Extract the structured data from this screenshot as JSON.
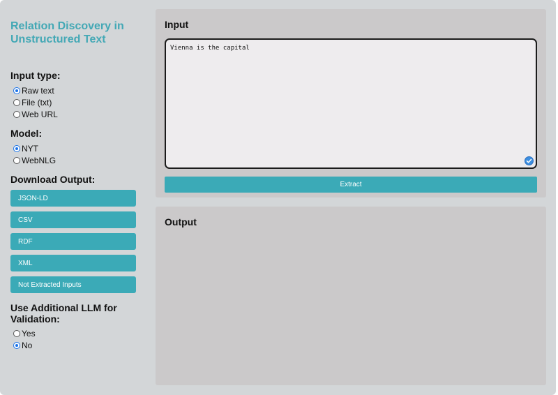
{
  "sidebar": {
    "title_line1": "Relation Discovery in",
    "title_line2": "Unstructured Text",
    "input_type": {
      "label": "Input type:",
      "options": [
        "Raw text",
        "File (txt)",
        "Web URL"
      ],
      "selected": "Raw text"
    },
    "model": {
      "label": "Model:",
      "options": [
        "NYT",
        "WebNLG"
      ],
      "selected": "NYT"
    },
    "download": {
      "label": "Download Output:",
      "buttons": [
        "JSON-LD",
        "CSV",
        "RDF",
        "XML",
        "Not Extracted Inputs"
      ]
    },
    "validation": {
      "label_line1": "Use Additional LLM for",
      "label_line2": "Validation:",
      "options": [
        "Yes",
        "No"
      ],
      "selected": "No"
    }
  },
  "input_panel": {
    "title": "Input",
    "text_value": "Vienna is the capital",
    "extract_label": "Extract"
  },
  "output_panel": {
    "title": "Output"
  },
  "colors": {
    "accent": "#3baab7",
    "title": "#43a8b5",
    "background": "#d3d6d8",
    "panel": "#cbc9ca",
    "radio_checked": "#1a73e8"
  }
}
